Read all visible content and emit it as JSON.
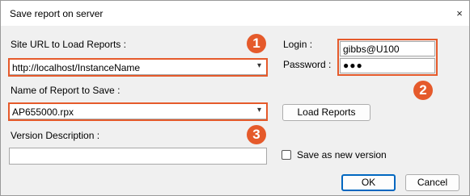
{
  "window": {
    "title": "Save report on server",
    "close_glyph": "×"
  },
  "site_url": {
    "label": "Site URL to Load Reports :",
    "value": "http://localhost/InstanceName"
  },
  "report_name": {
    "label": "Name of Report to Save :",
    "value": "AP655000.rpx"
  },
  "version": {
    "label": "Version Description :",
    "value": ""
  },
  "login": {
    "label": "Login :",
    "value": "gibbs@U100"
  },
  "password": {
    "label": "Password :",
    "value": "●●●"
  },
  "buttons": {
    "load": "Load Reports",
    "ok": "OK",
    "cancel": "Cancel"
  },
  "checkbox": {
    "label": "Save as new version",
    "checked": false
  },
  "badges": [
    "1",
    "2",
    "3"
  ],
  "colors": {
    "highlight": "#e55a2b",
    "ok_border": "#0067c0"
  },
  "icons": {
    "dropdown": "▾",
    "close": "close-icon"
  }
}
